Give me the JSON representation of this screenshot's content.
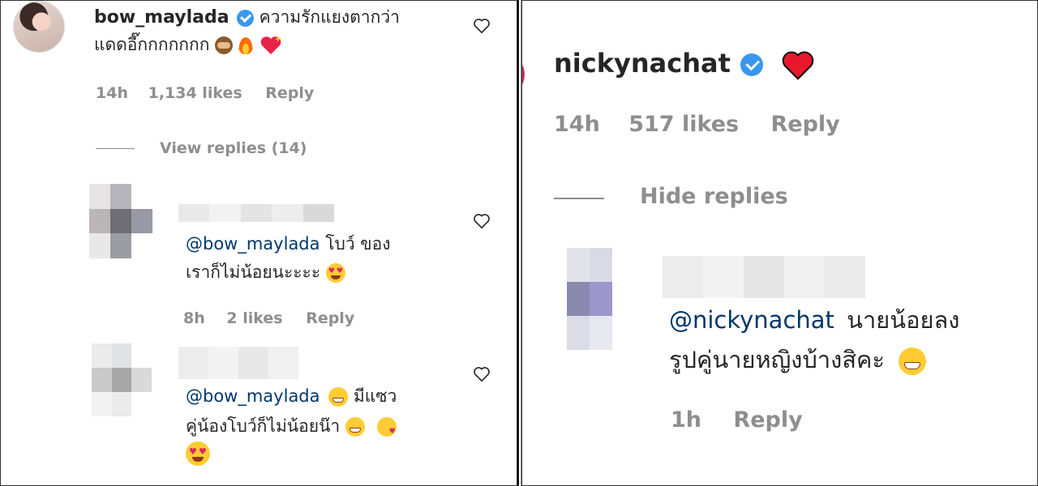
{
  "left": {
    "main_comment": {
      "username": "bow_maylada",
      "text_line1": "ความรักแยงตากว่า",
      "text_line2": "แดดอี๊กกกกกกก",
      "emojis": [
        "see-no-evil-monkey",
        "fire",
        "sparkling-heart"
      ],
      "time": "14h",
      "likes": "1,134 likes",
      "reply": "Reply"
    },
    "view_replies": "View replies (14)",
    "replies": [
      {
        "mention": "@bow_maylada",
        "text_line1": "โบว์ ของ",
        "text_line2": "เราก็ไม่น้อยนะะะะ",
        "emojis": [
          "heart-eyes"
        ],
        "time": "8h",
        "likes": "2 likes",
        "reply": "Reply"
      },
      {
        "mention": "@bow_maylada",
        "text_line1": "มีแซว",
        "text_line2": "คู่น้องโบว์ก็ไม่น้อยน๊า",
        "emojis": [
          "grinning",
          "grinning",
          "kissing-heart",
          "heart-eyes"
        ]
      }
    ]
  },
  "right": {
    "main_comment": {
      "username": "nickynachat",
      "emoji": "red-heart",
      "time": "14h",
      "likes": "517 likes",
      "reply": "Reply"
    },
    "hide_replies": "Hide replies",
    "reply": {
      "mention": "@nickynachat",
      "text_line1": "นายน้อยลง",
      "text_line2": "รูปคู่นายหญิงบ้างสิคะ",
      "emojis": [
        "grinning"
      ],
      "time": "1h",
      "reply": "Reply"
    }
  },
  "colors": {
    "text": "#262626",
    "meta": "#8e8e8e",
    "mention": "#00376b",
    "verified": "#3897f0",
    "heart": "#ed4956"
  }
}
